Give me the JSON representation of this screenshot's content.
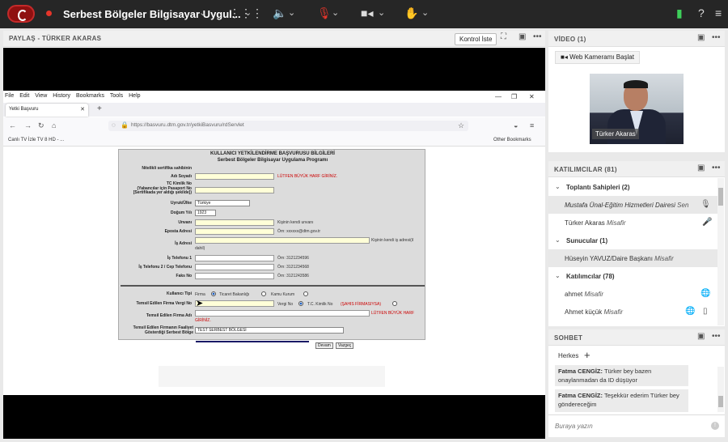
{
  "topbar": {
    "meeting_title": "Serbest Bölgeler Bilgisayar Uygul...",
    "icons": [
      "logo-icon",
      "record-indicator-icon",
      "grid-icon",
      "speaker-icon",
      "mic-muted-icon",
      "camera-icon",
      "hand-raise-icon",
      "signal-icon",
      "help-icon",
      "menu-icon"
    ],
    "colors": {
      "bar": "#262626",
      "record": "#e5352a",
      "speaker": "#3ecf5a",
      "mic_muted": "#e5352a",
      "signal": "#3ecf5a"
    }
  },
  "share": {
    "title": "PAYLAŞ  - TÜRKER AKARAS",
    "control_button": "Kontrol İste"
  },
  "browser": {
    "menu": [
      "File",
      "Edit",
      "View",
      "History",
      "Bookmarks",
      "Tools",
      "Help"
    ],
    "tab_title": "Yetki Başvuru",
    "url": "https://basvuru.dtm.gov.tr/yetkiBasvuru/rdServlet",
    "bookmark_left": "Canlı TV İzle TV 8 HD - ...",
    "bookmark_right": "Other Bookmarks"
  },
  "form": {
    "header1": "KULLANICI YETKİLENDİRME BAŞVURUSU BİLGİLERİ",
    "header2": "Serbest Bölgeler Bilgisayar Uygulama Programı",
    "label_cert": "Nitelikli sertifika sahibinin",
    "label_name": "Adı Soyadı",
    "note_name": "LÜTFEN BÜYÜK HARF GİRİNİZ.",
    "label_tc": "TC Kimlik No\n(Yabancılar için Pasaport No\n[Sertifikada yer aldığı şekilde])",
    "label_country": "Uyruk/Ülke",
    "country_value": "Türkiye",
    "label_birth": "Doğum Yılı",
    "birth_value": "1923",
    "label_title": "Unvanı",
    "note_title": "Kişinin kendi unvanı",
    "label_email": "Eposta Adresi",
    "note_email": "Örn: xxxxxx@dtm.gov.tr",
    "label_work_addr": "İş Adresi",
    "note_work_addr1": "Kişinin kendi iş adresi(il",
    "note_work_addr2": "dahil)",
    "label_phone1": "İş Telefonu 1",
    "note_phone1": "Örn: 3121234596",
    "label_phone2": "İş Telefonu 2 / Cep Telefonu",
    "note_phone2": "Örn: 3121234568",
    "label_fax": "Faks No",
    "note_fax": "Örn: 3121243586",
    "label_user_type": "Kullanıcı Tipi",
    "opt_firma": "Firma",
    "opt_ticaret": "Ticaret Bakanlığı",
    "opt_kamu": "Kamu Kurum",
    "label_tax": "Temsil Edilen Firma Vergi No",
    "opt_vergi": "Vergi No",
    "opt_tc": "T.C. Kimlik No",
    "opt_tc_note": "(ŞAHIS FİRMASIYSA)",
    "label_company": "Temsil Edilen Firma Adı",
    "note_company1": "LÜTFEN BÜYÜK HARF",
    "note_company2": "GİRİNİZ.",
    "label_zone": "Temsil Edilen Firmanın Faaliyet Gösterdiği Serbest Bölge",
    "zone_value": "TEST SERBEST BÖLGESİ",
    "btn_continue": "Devam",
    "btn_cancel": "Vazgeç"
  },
  "video": {
    "title": "VİDEO (1)",
    "webcam_button": "Web Kameramı Başlat",
    "speaker_name": "Türker Akaras"
  },
  "participants": {
    "title": "KATILIMCILAR  (81)",
    "sections": [
      {
        "label": "Toplantı Sahipleri (2)",
        "members": [
          {
            "name": "Mustafa Ünal-Eğitim Hizmetleri Dairesi",
            "role": "Sen",
            "italic": true
          },
          {
            "name": "Türker Akaras",
            "role": "Misafir"
          }
        ]
      },
      {
        "label": "Sunucular (1)",
        "members": [
          {
            "name": "Hüseyin YAVUZ/Daire Başkanı",
            "role": "Misafir"
          }
        ]
      },
      {
        "label": "Katılımcılar (78)",
        "members": [
          {
            "name": "ahmet",
            "role": "Misafir"
          },
          {
            "name": "Ahmet küçük",
            "role": "Misafir"
          }
        ]
      }
    ]
  },
  "chat": {
    "title": "SOHBET",
    "tab": "Herkes",
    "messages": [
      {
        "sender": "Fatma CENGİZ:",
        "text": "Türker bey bazen onaylanmadan da ID düşüyor"
      },
      {
        "sender": "Fatma CENGİZ:",
        "text": "Teşekkür ederim Türker bey göndereceğim"
      }
    ],
    "placeholder": "Buraya yazın"
  }
}
